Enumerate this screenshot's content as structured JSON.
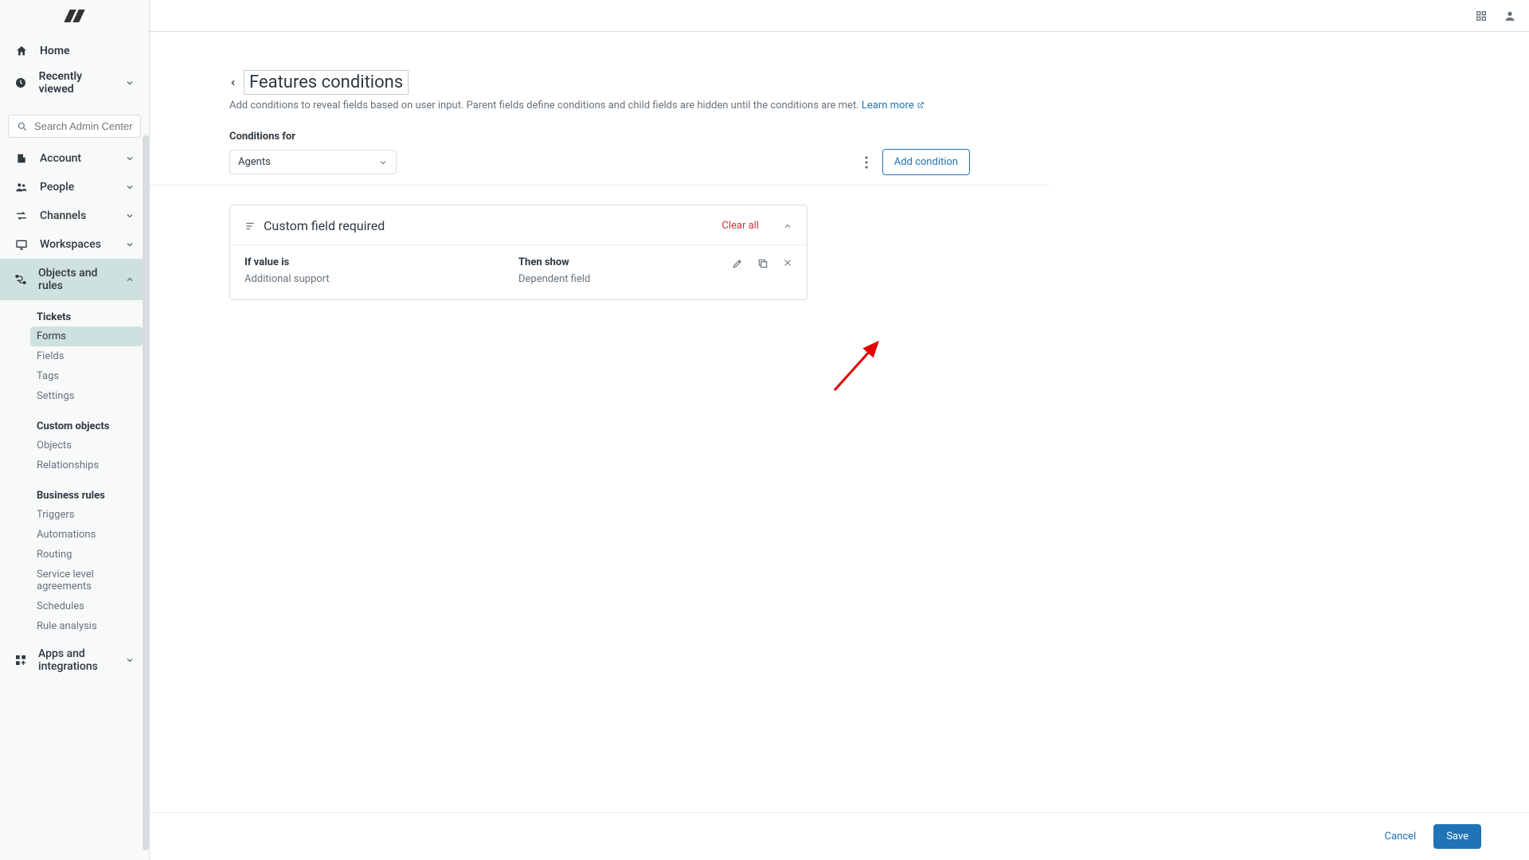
{
  "sidebar": {
    "home": "Home",
    "recent": "Recently viewed",
    "search_placeholder": "Search Admin Center",
    "sections": [
      {
        "label": "Account"
      },
      {
        "label": "People"
      },
      {
        "label": "Channels"
      },
      {
        "label": "Workspaces"
      },
      {
        "label": "Objects and rules"
      },
      {
        "label": "Apps and integrations"
      }
    ],
    "objects_rules": {
      "g1_header": "Tickets",
      "g1": [
        "Forms",
        "Fields",
        "Tags",
        "Settings"
      ],
      "g2_header": "Custom objects",
      "g2": [
        "Objects",
        "Relationships"
      ],
      "g3_header": "Business rules",
      "g3": [
        "Triggers",
        "Automations",
        "Routing",
        "Service level agreements",
        "Schedules",
        "Rule analysis"
      ]
    }
  },
  "page": {
    "title": "Features conditions",
    "desc_pre": "Add conditions to reveal fields based on user input. Parent fields define conditions and child fields are hidden until the conditions are met. ",
    "learn_more": "Learn more",
    "conditions_for_label": "Conditions for",
    "conditions_for_value": "Agents",
    "add_condition": "Add condition"
  },
  "card": {
    "title": "Custom field required",
    "clear_all": "Clear all",
    "if_label": "If value is",
    "if_value": "Additional support",
    "then_label": "Then show",
    "then_value": "Dependent field"
  },
  "footer": {
    "cancel": "Cancel",
    "save": "Save"
  }
}
